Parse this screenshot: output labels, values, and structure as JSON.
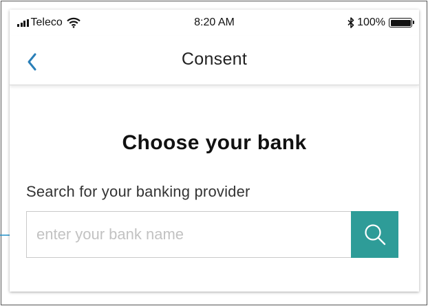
{
  "status_bar": {
    "carrier": "Teleco",
    "time": "8:20 AM",
    "battery_percent": "100%",
    "battery_level": 1.0
  },
  "nav": {
    "title": "Consent",
    "back_icon": "chevron-left-icon",
    "accent_color": "#2a7fb8"
  },
  "main": {
    "heading": "Choose your bank",
    "search_label": "Search for your banking provider",
    "search_placeholder": "enter your bank name",
    "search_value": "",
    "search_icon": "search-icon",
    "search_button_color": "#2e9c98"
  },
  "annotation": {
    "pointer_color": "#1f8fc8"
  }
}
